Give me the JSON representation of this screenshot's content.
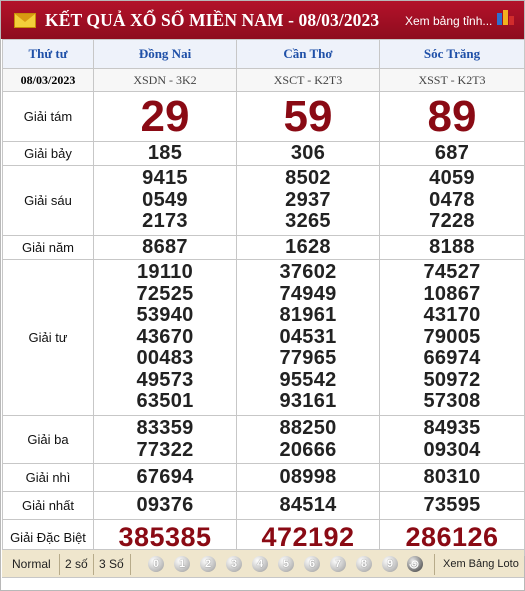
{
  "header": {
    "title": "KẾT QUẢ XỔ SỐ MIỀN NAM - 08/03/2023",
    "view_link": "Xem bảng tỉnh..."
  },
  "table": {
    "corner_label": "Thứ tư",
    "date": "08/03/2023",
    "provinces": [
      {
        "name": "Đồng Nai",
        "code": "XSDN - 3K2"
      },
      {
        "name": "Cần Thơ",
        "code": "XSCT - K2T3"
      },
      {
        "name": "Sóc Trăng",
        "code": "XSST - K2T3"
      }
    ],
    "prizes": {
      "g8": {
        "label": "Giải tám",
        "values": [
          "29",
          "59",
          "89"
        ]
      },
      "g7": {
        "label": "Giải bảy",
        "values": [
          "185",
          "306",
          "687"
        ]
      },
      "g6": {
        "label": "Giải sáu",
        "values": [
          [
            "9415",
            "0549",
            "2173"
          ],
          [
            "8502",
            "2937",
            "3265"
          ],
          [
            "4059",
            "0478",
            "7228"
          ]
        ]
      },
      "g5": {
        "label": "Giải năm",
        "values": [
          "8687",
          "1628",
          "8188"
        ]
      },
      "g4": {
        "label": "Giải tư",
        "values": [
          [
            "19110",
            "72525",
            "53940",
            "43670",
            "00483",
            "49573",
            "63501"
          ],
          [
            "37602",
            "74949",
            "81961",
            "04531",
            "77965",
            "95542",
            "93161"
          ],
          [
            "74527",
            "10867",
            "43170",
            "79005",
            "66974",
            "50972",
            "57308"
          ]
        ]
      },
      "g3": {
        "label": "Giải ba",
        "values": [
          [
            "83359",
            "77322"
          ],
          [
            "88250",
            "20666"
          ],
          [
            "84935",
            "09304"
          ]
        ]
      },
      "g2": {
        "label": "Giải nhì",
        "values": [
          "67694",
          "08998",
          "80310"
        ]
      },
      "g1": {
        "label": "Giải nhất",
        "values": [
          "09376",
          "84514",
          "73595"
        ]
      },
      "db": {
        "label": "Giải Đặc Biệt",
        "values": [
          "385385",
          "472192",
          "286126"
        ]
      }
    }
  },
  "footer": {
    "modes": [
      "Normal",
      "2 số",
      "3 Số"
    ],
    "digits": [
      "0",
      "1",
      "2",
      "3",
      "4",
      "5",
      "6",
      "7",
      "8",
      "9"
    ],
    "loto_link": "Xem Bảng Loto"
  },
  "colors": {
    "header_bg": "#9e0f24",
    "prize_red": "#8a0a14",
    "province_blue": "#1f50a8",
    "footer_bg": "#efe6cd"
  },
  "icons": {
    "header_left": "envelope-icon",
    "header_right": "bar-flag-icon",
    "footer_last": "spiral-icon"
  }
}
